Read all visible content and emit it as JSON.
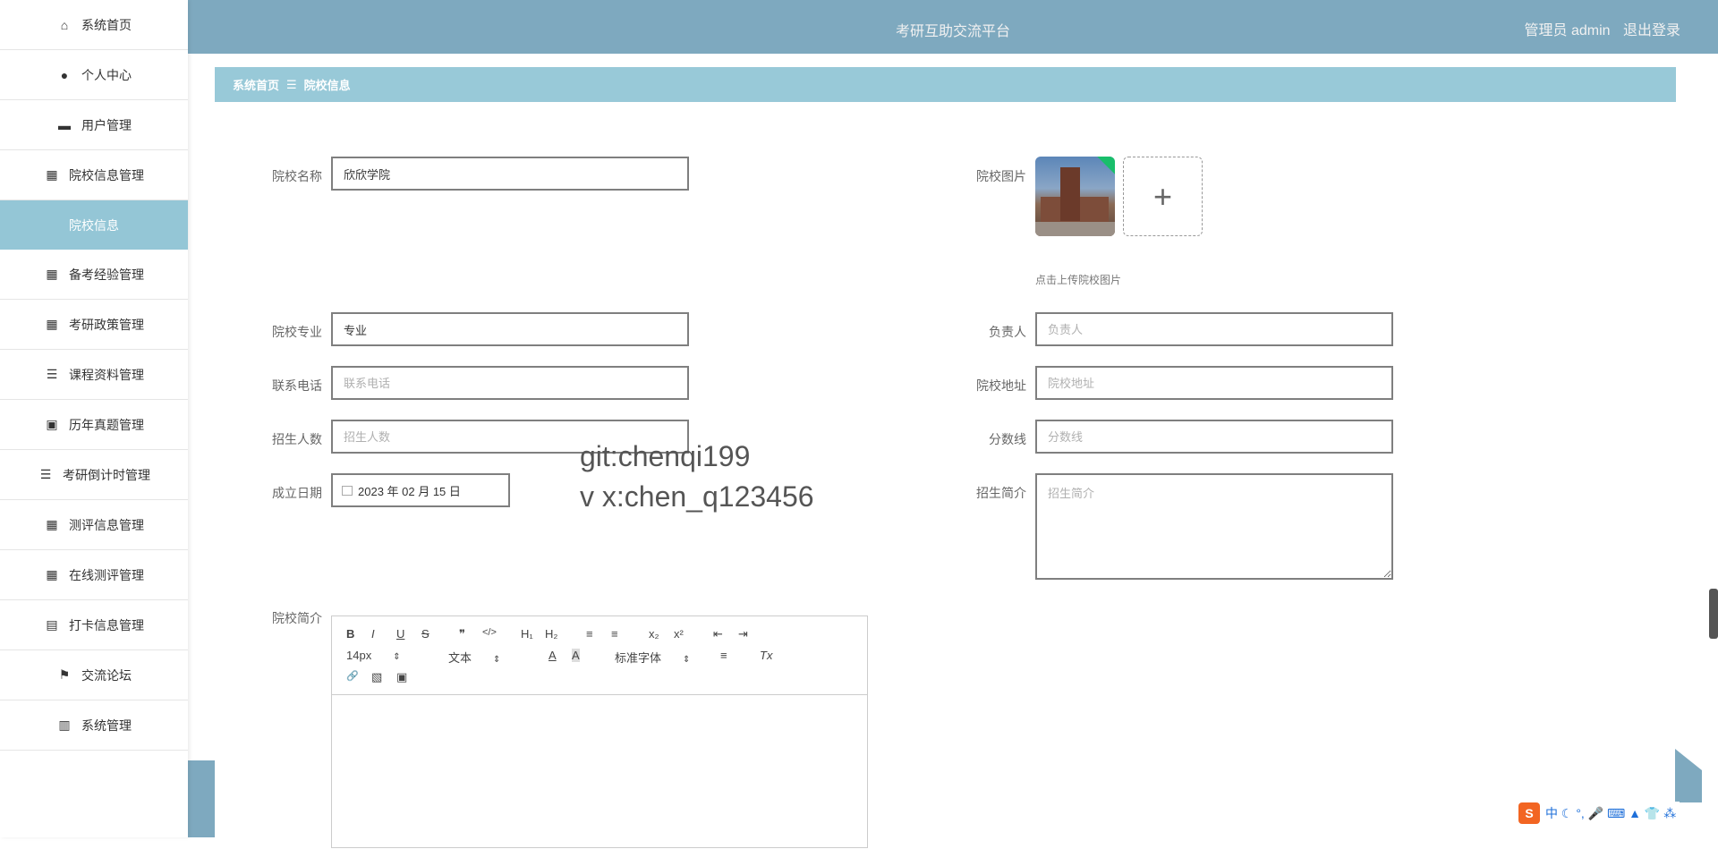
{
  "sidebar": {
    "items": [
      {
        "label": "系统首页",
        "icon": "home-icon",
        "glyph": "⌂"
      },
      {
        "label": "个人中心",
        "icon": "user-icon",
        "glyph": "●"
      },
      {
        "label": "用户管理",
        "icon": "user-manage-icon",
        "glyph": "▬"
      },
      {
        "label": "院校信息管理",
        "icon": "grid-icon",
        "glyph": "▦"
      },
      {
        "label": "院校信息",
        "icon": "",
        "glyph": ""
      },
      {
        "label": "备考经验管理",
        "icon": "grid-icon",
        "glyph": "▦"
      },
      {
        "label": "考研政策管理",
        "icon": "grid-icon",
        "glyph": "▦"
      },
      {
        "label": "课程资料管理",
        "icon": "list-icon",
        "glyph": "☰"
      },
      {
        "label": "历年真题管理",
        "icon": "wallet-icon",
        "glyph": "▣"
      },
      {
        "label": "考研倒计时管理",
        "icon": "list-icon",
        "glyph": "☰"
      },
      {
        "label": "测评信息管理",
        "icon": "grid-icon",
        "glyph": "▦"
      },
      {
        "label": "在线测评管理",
        "icon": "grid-icon",
        "glyph": "▦"
      },
      {
        "label": "打卡信息管理",
        "icon": "clipboard-icon",
        "glyph": "▤"
      },
      {
        "label": "交流论坛",
        "icon": "flag-icon",
        "glyph": "⚑"
      },
      {
        "label": "系统管理",
        "icon": "book-icon",
        "glyph": "▥"
      }
    ]
  },
  "header": {
    "title": "考研互助交流平台",
    "user": "管理员 admin",
    "logout": "退出登录"
  },
  "breadcrumb": {
    "home": "系统首页",
    "sep": "☰",
    "current": "院校信息"
  },
  "form": {
    "name_label": "院校名称",
    "name_value": "欣欣学院",
    "image_label": "院校图片",
    "upload_hint": "点击上传院校图片",
    "upload_plus": "+",
    "major_label": "院校专业",
    "major_value": "专业",
    "manager_label": "负责人",
    "manager_placeholder": "负责人",
    "phone_label": "联系电话",
    "phone_placeholder": "联系电话",
    "address_label": "院校地址",
    "address_placeholder": "院校地址",
    "enroll_label": "招生人数",
    "enroll_placeholder": "招生人数",
    "score_label": "分数线",
    "score_placeholder": "分数线",
    "date_label": "成立日期",
    "date_value": "2023 年 02 月 15 日",
    "intro_label": "招生简介",
    "intro_placeholder": "招生简介",
    "desc_label": "院校简介"
  },
  "editor": {
    "bold": "B",
    "italic": "I",
    "underline": "U",
    "strike": "S",
    "quote": "❞",
    "code": "</>",
    "h1": "H₁",
    "h2": "H₂",
    "ol": "≡",
    "ul": "≡",
    "sub": "x₂",
    "sup": "x²",
    "outdent": "⇤",
    "indent": "⇥",
    "size": "14px",
    "format": "文本",
    "color": "A",
    "bg": "A",
    "font": "标准字体",
    "align": "≡",
    "clear": "Tx",
    "link": "🔗",
    "image": "▧",
    "video": "▣"
  },
  "watermark": {
    "line1": "git:chenqi199",
    "line2": "v x:chen_q123456"
  },
  "ime": {
    "logo": "S",
    "text": "中 ☾ °, 🎤 ⌨ ▲ 👕 ⁂"
  }
}
